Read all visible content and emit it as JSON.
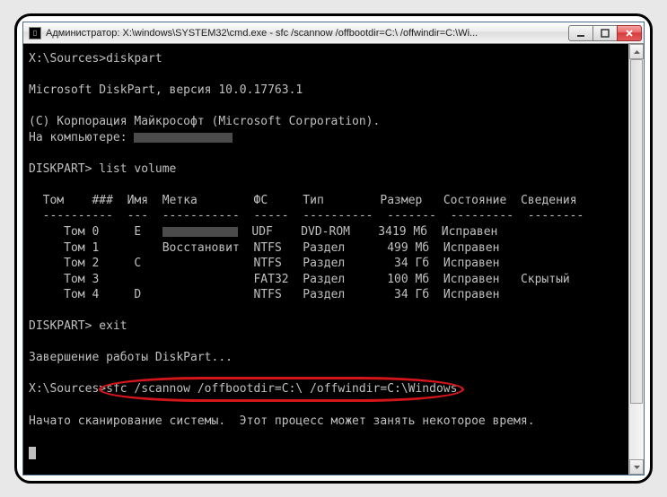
{
  "titlebar": {
    "icon_glyph": "C:\\",
    "title": "Администратор: X:\\windows\\SYSTEM32\\cmd.exe - sfc  /scannow /offbootdir=C:\\ /offwindir=C:\\Wi..."
  },
  "console": {
    "prompt1_path": "X:\\Sources>",
    "cmd1": "diskpart",
    "version_line": "Microsoft DiskPart, версия 10.0.17763.1",
    "copyright": "(C) Корпорация Майкрософт (Microsoft Corporation).",
    "computer_label": "На компьютере: ",
    "dp_prompt": "DISKPART> ",
    "cmd_list": "list volume",
    "headers": {
      "tom": "Том",
      "num": "###",
      "name": "Имя",
      "label": "Метка",
      "fs": "ФС",
      "type": "Тип",
      "size": "Размер",
      "state": "Состояние",
      "info": "Сведения"
    },
    "rows": [
      {
        "tom": "Том 0",
        "name": "E",
        "label": "",
        "fs": "UDF",
        "type": "DVD-ROM",
        "size": "3419 Мб",
        "state": "Исправен",
        "info": ""
      },
      {
        "tom": "Том 1",
        "name": "",
        "label": "Восстановит",
        "fs": "NTFS",
        "type": "Раздел",
        "size": "499 Мб",
        "state": "Исправен",
        "info": ""
      },
      {
        "tom": "Том 2",
        "name": "C",
        "label": "",
        "fs": "NTFS",
        "type": "Раздел",
        "size": "34 Гб",
        "state": "Исправен",
        "info": ""
      },
      {
        "tom": "Том 3",
        "name": "",
        "label": "",
        "fs": "FAT32",
        "type": "Раздел",
        "size": "100 Мб",
        "state": "Исправен",
        "info": "Скрытый"
      },
      {
        "tom": "Том 4",
        "name": "D",
        "label": "",
        "fs": "NTFS",
        "type": "Раздел",
        "size": "34 Гб",
        "state": "Исправен",
        "info": ""
      }
    ],
    "cmd_exit": "exit",
    "exit_msg": "Завершение работы DiskPart...",
    "prompt2_path": "X:\\Sources>",
    "cmd_sfc": "sfc /scannow /offbootdir=C:\\ /offwindir=C:\\Windows",
    "scan_msg": "Начато сканирование системы.  Этот процесс может занять некоторое время."
  }
}
